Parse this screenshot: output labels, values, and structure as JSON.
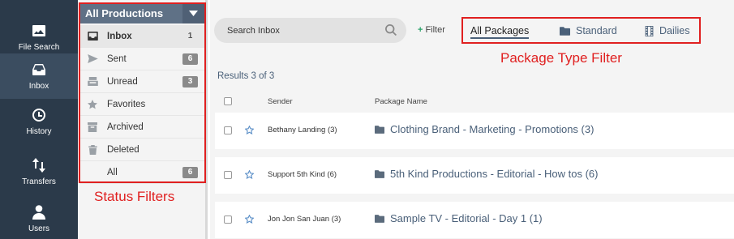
{
  "nav": {
    "items": [
      {
        "label": "File Search",
        "icon": "image-icon"
      },
      {
        "label": "Inbox",
        "icon": "inbox-icon"
      },
      {
        "label": "History",
        "icon": "clock-icon"
      },
      {
        "label": "Transfers",
        "icon": "transfer-arrows-icon"
      },
      {
        "label": "Users",
        "icon": "user-icon"
      }
    ]
  },
  "production_selector": {
    "label": "All Productions"
  },
  "status_filters": [
    {
      "label": "Inbox",
      "count": "1"
    },
    {
      "label": "Sent",
      "count": "6"
    },
    {
      "label": "Unread",
      "count": "3"
    },
    {
      "label": "Favorites",
      "count": ""
    },
    {
      "label": "Archived",
      "count": ""
    },
    {
      "label": "Deleted",
      "count": ""
    },
    {
      "label": "All",
      "count": "6"
    }
  ],
  "annotations": {
    "status": "Status Filters",
    "package_type": "Package Type Filter"
  },
  "search": {
    "placeholder": "Search Inbox"
  },
  "filter_button": {
    "label": "Filter"
  },
  "package_tabs": [
    {
      "label": "All Packages"
    },
    {
      "label": "Standard"
    },
    {
      "label": "Dailies"
    }
  ],
  "results": "Results 3 of 3",
  "table": {
    "headers": {
      "sender": "Sender",
      "package": "Package Name"
    },
    "rows": [
      {
        "sender": "Bethany Landing (3)",
        "package": "Clothing Brand - Marketing - Promotions (3)"
      },
      {
        "sender": "Support 5th Kind (6)",
        "package": "5th Kind Productions - Editorial - How tos (6)"
      },
      {
        "sender": "Jon Jon San Juan (3)",
        "package": "Sample TV - Editorial - Day 1 (1)"
      }
    ]
  },
  "colors": {
    "nav_bg": "#2b3a4a",
    "accent": "#4a6079",
    "annotation_red": "#e02020"
  }
}
